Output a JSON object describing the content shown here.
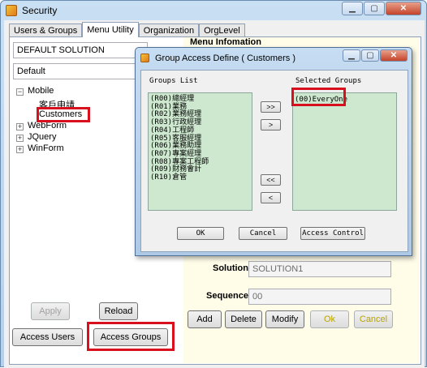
{
  "window": {
    "title": "Security"
  },
  "tabs": [
    {
      "label": "Users & Groups"
    },
    {
      "label": "Menu Utility"
    },
    {
      "label": "Organization"
    },
    {
      "label": "OrgLevel"
    }
  ],
  "solution_field": "DEFAULT SOLUTION",
  "default_field": "Default",
  "tree": {
    "mobile": "Mobile",
    "child1": "客戶申請",
    "child2": "Customers",
    "webform": "WebForm",
    "jquery": "JQuery",
    "winform": "WinForm"
  },
  "left_buttons": {
    "apply": "Apply",
    "reload": "Reload",
    "access_users": "Access Users",
    "access_groups": "Access Groups"
  },
  "menu_info": {
    "title": "Menu Infomation",
    "solution_label": "Solution",
    "solution_value": "SOLUTION1",
    "sequence_label": "Sequence",
    "sequence_value": "00",
    "add": "Add",
    "delete": "Delete",
    "modify": "Modify",
    "ok": "Ok",
    "cancel": "Cancel"
  },
  "dialog": {
    "title": "Group Access Define ( Customers )",
    "groups_header": "Groups List",
    "selected_header": "Selected Groups",
    "groups": [
      "(R00)總經理",
      "(R01)業務",
      "(R02)業務經理",
      "(R03)行政經理",
      "(R04)工程師",
      "(R05)客服經理",
      "(R06)業務助理",
      "(R07)專案經理",
      "(R08)專案工程師",
      "(R09)財務會計",
      "(R10)倉管"
    ],
    "selected": [
      "(00)EveryOne"
    ],
    "add_all": ">>",
    "add_one": ">",
    "remove_all": "<<",
    "remove_one": "<",
    "ok": "OK",
    "cancel": "Cancel",
    "access_control": "Access Control"
  }
}
